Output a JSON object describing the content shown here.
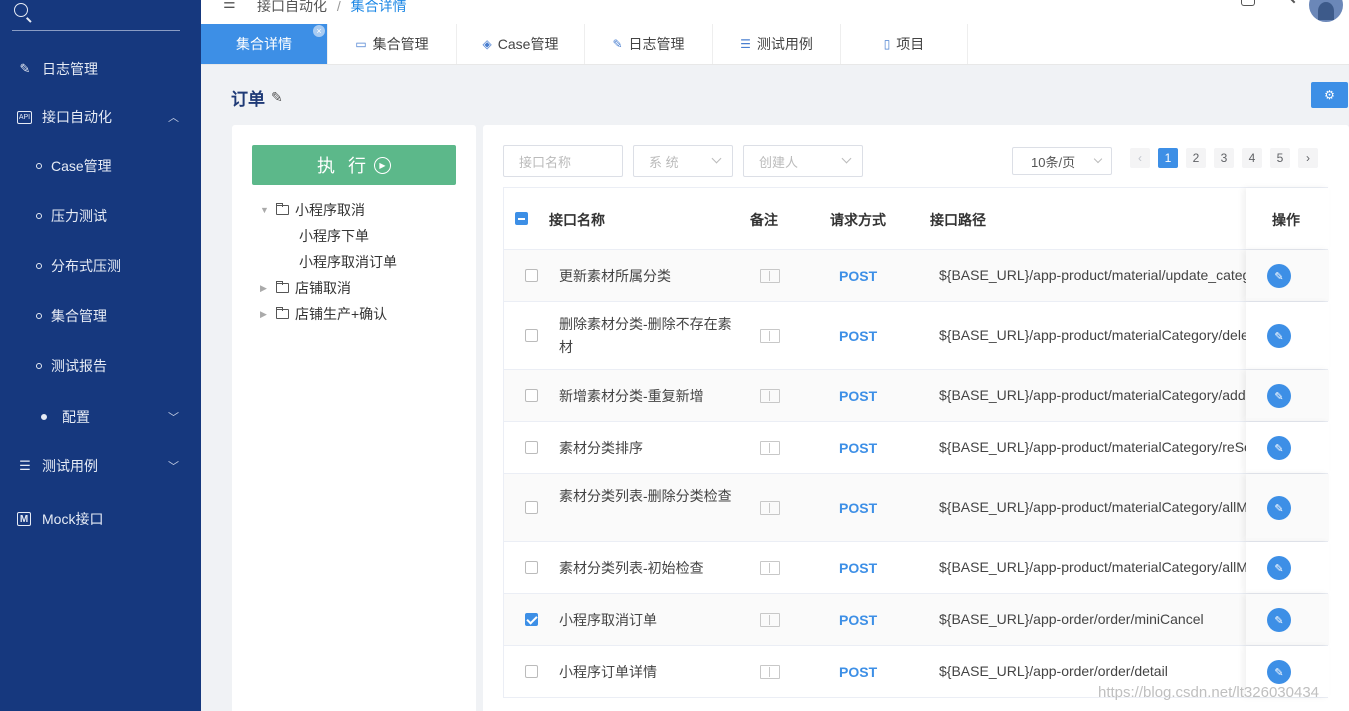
{
  "sidebar": {
    "items": [
      {
        "label": "日志管理",
        "icon": "edit-doc-icon"
      },
      {
        "label": "接口自动化",
        "icon": "api-icon"
      },
      {
        "label": "Case管理"
      },
      {
        "label": "压力测试"
      },
      {
        "label": "分布式压测"
      },
      {
        "label": "集合管理"
      },
      {
        "label": "测试报告"
      },
      {
        "label": "配置"
      },
      {
        "label": "测试用例",
        "icon": "list-icon"
      },
      {
        "label": "Mock接口",
        "icon": "m-icon"
      }
    ]
  },
  "header": {
    "breadcrumb": [
      "接口自动化",
      "集合详情"
    ],
    "separator": "/"
  },
  "tabs": [
    {
      "label": "集合详情",
      "close": "×"
    },
    {
      "label": "集合管理"
    },
    {
      "label": "Case管理"
    },
    {
      "label": "日志管理"
    },
    {
      "label": "测试用例"
    },
    {
      "label": "项目"
    }
  ],
  "page": {
    "title": "订单",
    "execute_label": "执 行"
  },
  "tree": [
    {
      "label": "小程序取消",
      "expanded": true
    },
    {
      "label": "小程序下单"
    },
    {
      "label": "小程序取消订单"
    },
    {
      "label": "店铺取消",
      "expanded": false
    },
    {
      "label": "店铺生产+确认",
      "expanded": false
    }
  ],
  "filters": {
    "name_placeholder": "接口名称",
    "system_placeholder": "系 统",
    "creator_placeholder": "创建人",
    "page_size": "10条/页"
  },
  "pagination": {
    "pages": [
      "1",
      "2",
      "3",
      "4",
      "5"
    ],
    "current": "1"
  },
  "table": {
    "headers": {
      "name": "接口名称",
      "note": "备注",
      "method": "请求方式",
      "path": "接口路径",
      "op": "操作"
    },
    "rows": [
      {
        "name": "更新素材所属分类",
        "method": "POST",
        "path": "${BASE_URL}/app-product/material/update_category",
        "checked": false
      },
      {
        "name": "删除素材分类-删除不存在素材",
        "method": "POST",
        "path": "${BASE_URL}/app-product/materialCategory/delete",
        "checked": false
      },
      {
        "name": "新增素材分类-重复新增",
        "method": "POST",
        "path": "${BASE_URL}/app-product/materialCategory/add",
        "checked": false
      },
      {
        "name": "素材分类排序",
        "method": "POST",
        "path": "${BASE_URL}/app-product/materialCategory/reSort",
        "checked": false
      },
      {
        "name": "素材分类列表-删除分类检查",
        "method": "POST",
        "path": "${BASE_URL}/app-product/materialCategory/allMaterial",
        "checked": false
      },
      {
        "name": "素材分类列表-初始检查",
        "method": "POST",
        "path": "${BASE_URL}/app-product/materialCategory/allMaterial",
        "checked": false
      },
      {
        "name": "小程序取消订单",
        "method": "POST",
        "path": "${BASE_URL}/app-order/order/miniCancel",
        "checked": true
      },
      {
        "name": "小程序订单详情",
        "method": "POST",
        "path": "${BASE_URL}/app-order/order/detail",
        "checked": false
      }
    ]
  },
  "watermark": "https://blog.csdn.net/lt326030434",
  "colors": {
    "sidebar_bg": "#16387e",
    "accent": "#3d8fe6",
    "execute_bg": "#5cb88a"
  }
}
